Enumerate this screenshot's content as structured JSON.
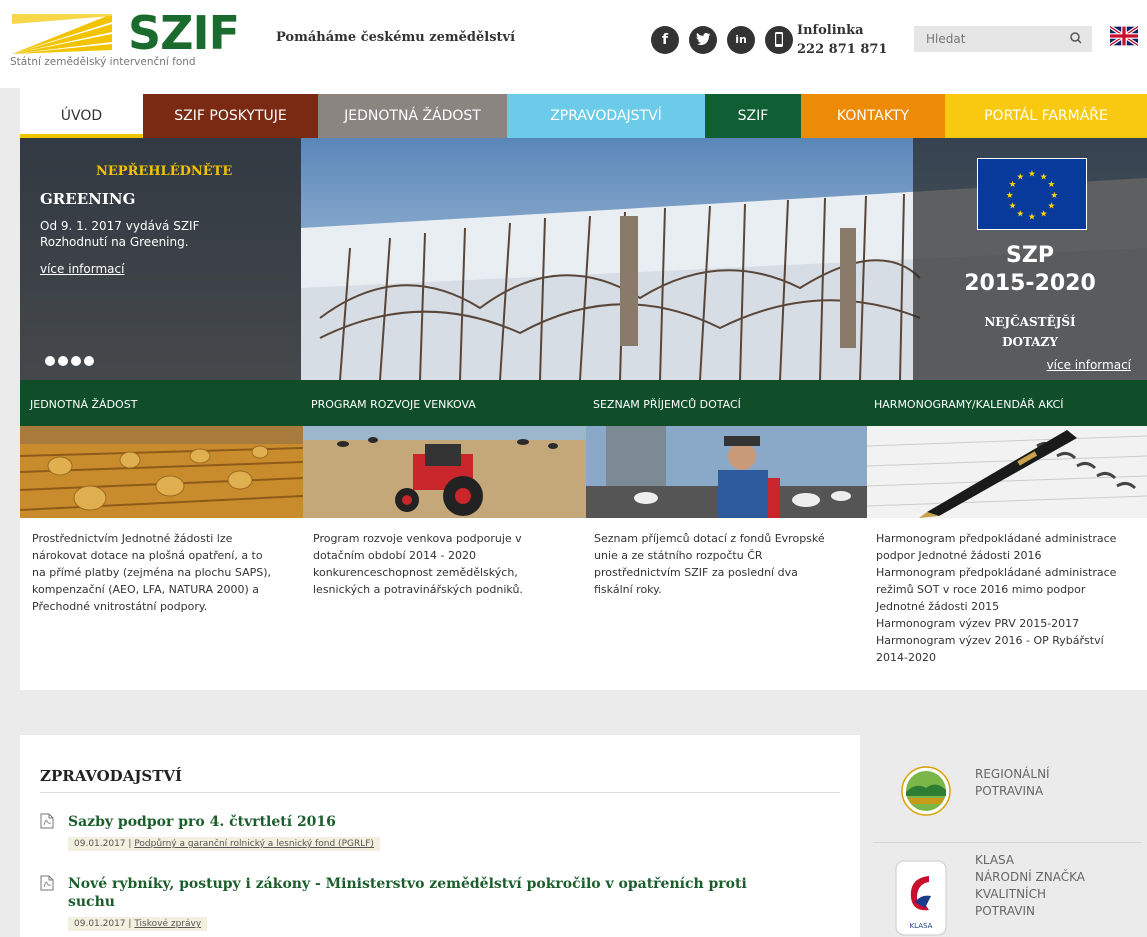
{
  "header": {
    "logo_text": "SZIF",
    "logo_sub": "Státní zemědělský intervenční fond",
    "slogan": "Pomáháme českému zemědělství",
    "social": [
      "f",
      "t",
      "in",
      "phone"
    ],
    "infolinka_label": "Infolinka",
    "infolinka_number": "222 871 871",
    "search_placeholder": "Hledat"
  },
  "nav": [
    {
      "label": "ÚVOD",
      "color": "#ffffff",
      "width": 123
    },
    {
      "label": "SZIF POSKYTUJE",
      "color": "#7a2a13",
      "width": 175
    },
    {
      "label": "JEDNOTNÁ ŽÁDOST",
      "color": "#8b8582",
      "width": 189
    },
    {
      "label": "ZPRAVODAJSTVÍ",
      "color": "#6ccbe8",
      "width": 198
    },
    {
      "label": "SZIF",
      "color": "#0f5e34",
      "width": 96
    },
    {
      "label": "KONTAKTY",
      "color": "#ee8b06",
      "width": 144
    },
    {
      "label": "PORTÁL FARMÁŘE",
      "color": "#f9c912",
      "width": 202
    }
  ],
  "hero": {
    "kicker": "NEPŘEHLÉDNĚTE",
    "title": "GREENING",
    "text_lines": [
      "Od 9. 1. 2017 vydává SZIF",
      "Rozhodnutí na Greening."
    ],
    "link": "více informací",
    "right_title_1": "SZP",
    "right_title_2": "2015-2020",
    "right_sub_1": "NEJČASTĚJŠÍ",
    "right_sub_2": "DOTAZY",
    "right_link": "více informací"
  },
  "tiles": [
    {
      "heading": "JEDNOTNÁ ŽÁDOST",
      "lines": [
        "Prostřednictvím Jednotné žádosti lze",
        "nárokovat dotace na plošná opatření, a to",
        "na přímé platby (zejména na plochu SAPS),",
        "kompenzační (AEO, LFA, NATURA 2000) a",
        "Přechodné vnitrostátní podpory."
      ]
    },
    {
      "heading": "PROGRAM ROZVOJE VENKOVA",
      "lines": [
        "Program rozvoje venkova podporuje v",
        "dotačním období 2014 - 2020",
        "konkurenceschopnost zemědělských,",
        "lesnických a potravinářských podniků."
      ]
    },
    {
      "heading": "SEZNAM PŘÍJEMCŮ DOTACÍ",
      "lines": [
        "Seznam příjemců dotací z fondů Evropské",
        "unie a ze státního rozpočtu ČR",
        "prostřednictvím SZIF za poslední dva",
        "fiskální roky."
      ]
    },
    {
      "heading": "HARMONOGRAMY/KALENDÁŘ AKCÍ",
      "lines": [
        "Harmonogram předpokládané administrace",
        "podpor Jednotné žádosti 2016",
        "Harmonogram předpokládané administrace",
        "režimů SOT v roce 2016 mimo podpor",
        "Jednotné žádosti 2015",
        "Harmonogram výzev PRV 2015-2017",
        "Harmonogram výzev 2016 - OP Rybářství",
        "2014-2020"
      ]
    }
  ],
  "news": {
    "title": "ZPRAVODAJSTVÍ",
    "items": [
      {
        "title_lines": [
          "Sazby podpor pro 4. čtvrtletí 2016"
        ],
        "date": "09.01.2017",
        "category": "Podpůrný a garanční rolnický a lesnický fond (PGRLF)"
      },
      {
        "title_lines": [
          "Nové rybníky, postupy i zákony - Ministerstvo zemědělství pokročilo v opatřeních proti",
          "suchu"
        ],
        "date": "09.01.2017",
        "category": "Tiskové zprávy"
      }
    ]
  },
  "sidebar": [
    {
      "lines": [
        "REGIONÁLNÍ",
        "POTRAVINA"
      ]
    },
    {
      "lines": [
        "KLASA",
        "NÁRODNÍ ZNAČKA",
        "KVALITNÍCH",
        "POTRAVIN"
      ]
    }
  ]
}
